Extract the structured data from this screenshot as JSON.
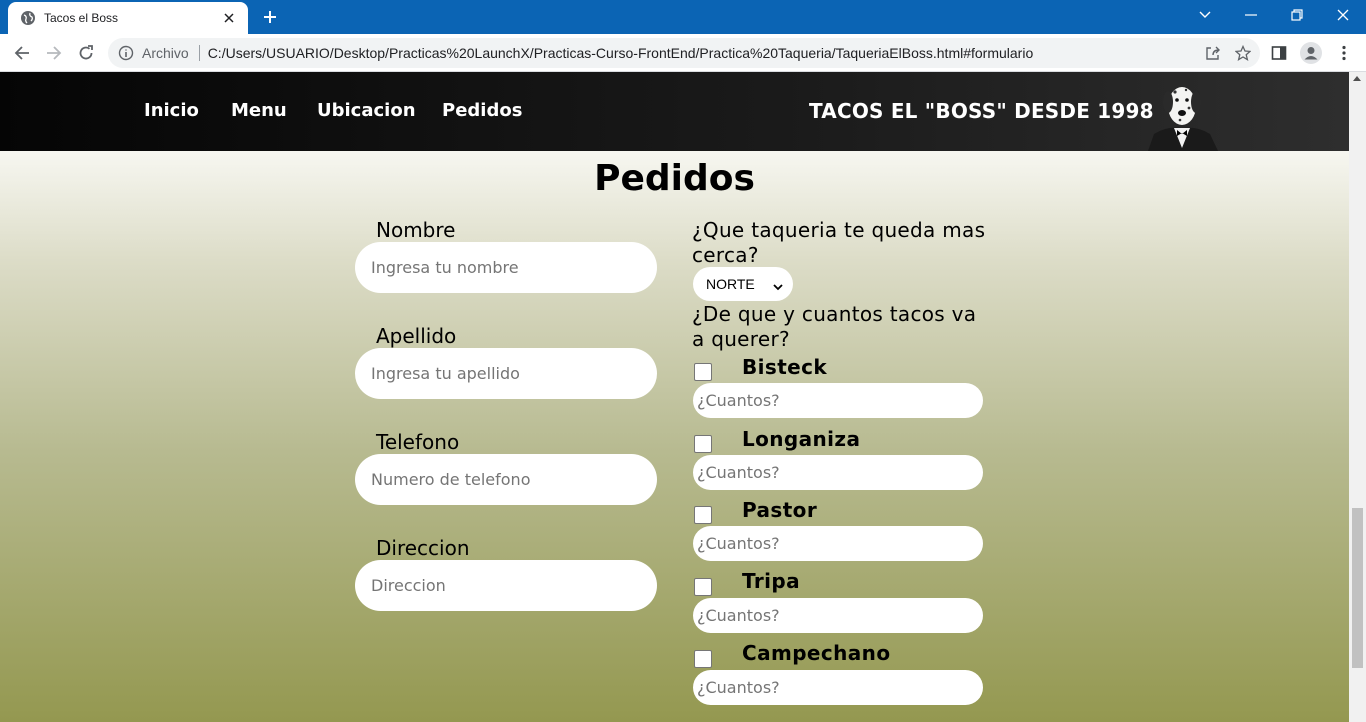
{
  "browser": {
    "tab_title": "Tacos el Boss",
    "omnibox_label": "Archivo",
    "url": "C:/Users/USUARIO/Desktop/Practicas%20LaunchX/Practicas-Curso-FrontEnd/Practica%20Taqueria/TaqueriaElBoss.html#formulario"
  },
  "nav": {
    "links": [
      "Inicio",
      "Menu",
      "Ubicacion",
      "Pedidos"
    ],
    "brand": "TACOS EL \"BOSS\" DESDE 1998"
  },
  "form": {
    "heading": "Pedidos",
    "fields": [
      {
        "label": "Nombre",
        "placeholder": "Ingresa tu nombre"
      },
      {
        "label": "Apellido",
        "placeholder": "Ingresa tu apellido"
      },
      {
        "label": "Telefono",
        "placeholder": "Numero de telefono"
      },
      {
        "label": "Direccion",
        "placeholder": "Direccion"
      }
    ],
    "question_branch": "¿Que taqueria te queda mas cerca?",
    "branch_selected": "NORTE",
    "question_tacos": "¿De que y cuantos tacos va a querer?",
    "tacos": [
      {
        "name": "Bisteck",
        "placeholder": "¿Cuantos?",
        "checked": false
      },
      {
        "name": "Longaniza",
        "placeholder": "¿Cuantos?",
        "checked": false
      },
      {
        "name": "Pastor",
        "placeholder": "¿Cuantos?",
        "checked": false
      },
      {
        "name": "Tripa",
        "placeholder": "¿Cuantos?",
        "checked": false
      },
      {
        "name": "Campechano",
        "placeholder": "¿Cuantos?",
        "checked": false
      }
    ]
  },
  "colors": {
    "browser_accent": "#0b64b4",
    "nav_background": "#111111",
    "gradient_top": "#f7f7f1",
    "gradient_bottom": "#949850"
  }
}
